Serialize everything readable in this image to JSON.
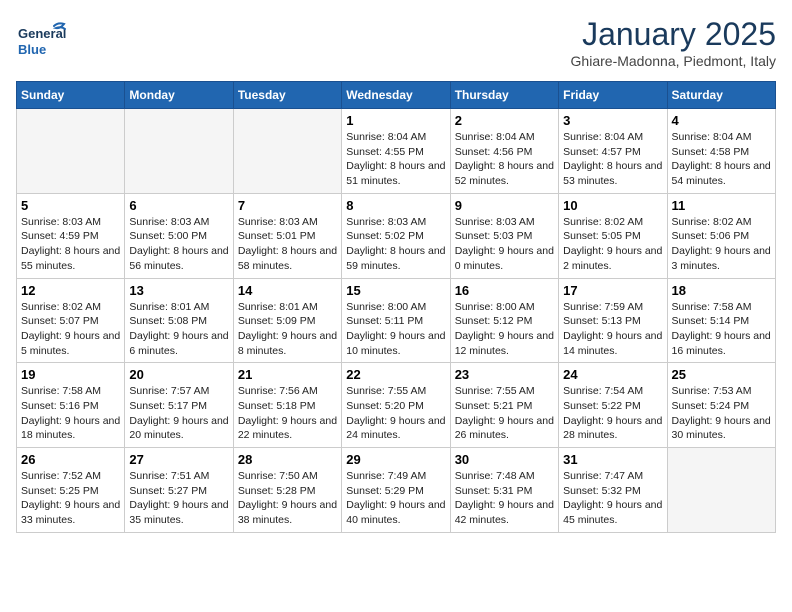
{
  "logo": {
    "general": "General",
    "blue": "Blue"
  },
  "title": "January 2025",
  "location": "Ghiare-Madonna, Piedmont, Italy",
  "days_of_week": [
    "Sunday",
    "Monday",
    "Tuesday",
    "Wednesday",
    "Thursday",
    "Friday",
    "Saturday"
  ],
  "weeks": [
    [
      {
        "num": "",
        "info": ""
      },
      {
        "num": "",
        "info": ""
      },
      {
        "num": "",
        "info": ""
      },
      {
        "num": "1",
        "info": "Sunrise: 8:04 AM\nSunset: 4:55 PM\nDaylight: 8 hours and 51 minutes."
      },
      {
        "num": "2",
        "info": "Sunrise: 8:04 AM\nSunset: 4:56 PM\nDaylight: 8 hours and 52 minutes."
      },
      {
        "num": "3",
        "info": "Sunrise: 8:04 AM\nSunset: 4:57 PM\nDaylight: 8 hours and 53 minutes."
      },
      {
        "num": "4",
        "info": "Sunrise: 8:04 AM\nSunset: 4:58 PM\nDaylight: 8 hours and 54 minutes."
      }
    ],
    [
      {
        "num": "5",
        "info": "Sunrise: 8:03 AM\nSunset: 4:59 PM\nDaylight: 8 hours and 55 minutes."
      },
      {
        "num": "6",
        "info": "Sunrise: 8:03 AM\nSunset: 5:00 PM\nDaylight: 8 hours and 56 minutes."
      },
      {
        "num": "7",
        "info": "Sunrise: 8:03 AM\nSunset: 5:01 PM\nDaylight: 8 hours and 58 minutes."
      },
      {
        "num": "8",
        "info": "Sunrise: 8:03 AM\nSunset: 5:02 PM\nDaylight: 8 hours and 59 minutes."
      },
      {
        "num": "9",
        "info": "Sunrise: 8:03 AM\nSunset: 5:03 PM\nDaylight: 9 hours and 0 minutes."
      },
      {
        "num": "10",
        "info": "Sunrise: 8:02 AM\nSunset: 5:05 PM\nDaylight: 9 hours and 2 minutes."
      },
      {
        "num": "11",
        "info": "Sunrise: 8:02 AM\nSunset: 5:06 PM\nDaylight: 9 hours and 3 minutes."
      }
    ],
    [
      {
        "num": "12",
        "info": "Sunrise: 8:02 AM\nSunset: 5:07 PM\nDaylight: 9 hours and 5 minutes."
      },
      {
        "num": "13",
        "info": "Sunrise: 8:01 AM\nSunset: 5:08 PM\nDaylight: 9 hours and 6 minutes."
      },
      {
        "num": "14",
        "info": "Sunrise: 8:01 AM\nSunset: 5:09 PM\nDaylight: 9 hours and 8 minutes."
      },
      {
        "num": "15",
        "info": "Sunrise: 8:00 AM\nSunset: 5:11 PM\nDaylight: 9 hours and 10 minutes."
      },
      {
        "num": "16",
        "info": "Sunrise: 8:00 AM\nSunset: 5:12 PM\nDaylight: 9 hours and 12 minutes."
      },
      {
        "num": "17",
        "info": "Sunrise: 7:59 AM\nSunset: 5:13 PM\nDaylight: 9 hours and 14 minutes."
      },
      {
        "num": "18",
        "info": "Sunrise: 7:58 AM\nSunset: 5:14 PM\nDaylight: 9 hours and 16 minutes."
      }
    ],
    [
      {
        "num": "19",
        "info": "Sunrise: 7:58 AM\nSunset: 5:16 PM\nDaylight: 9 hours and 18 minutes."
      },
      {
        "num": "20",
        "info": "Sunrise: 7:57 AM\nSunset: 5:17 PM\nDaylight: 9 hours and 20 minutes."
      },
      {
        "num": "21",
        "info": "Sunrise: 7:56 AM\nSunset: 5:18 PM\nDaylight: 9 hours and 22 minutes."
      },
      {
        "num": "22",
        "info": "Sunrise: 7:55 AM\nSunset: 5:20 PM\nDaylight: 9 hours and 24 minutes."
      },
      {
        "num": "23",
        "info": "Sunrise: 7:55 AM\nSunset: 5:21 PM\nDaylight: 9 hours and 26 minutes."
      },
      {
        "num": "24",
        "info": "Sunrise: 7:54 AM\nSunset: 5:22 PM\nDaylight: 9 hours and 28 minutes."
      },
      {
        "num": "25",
        "info": "Sunrise: 7:53 AM\nSunset: 5:24 PM\nDaylight: 9 hours and 30 minutes."
      }
    ],
    [
      {
        "num": "26",
        "info": "Sunrise: 7:52 AM\nSunset: 5:25 PM\nDaylight: 9 hours and 33 minutes."
      },
      {
        "num": "27",
        "info": "Sunrise: 7:51 AM\nSunset: 5:27 PM\nDaylight: 9 hours and 35 minutes."
      },
      {
        "num": "28",
        "info": "Sunrise: 7:50 AM\nSunset: 5:28 PM\nDaylight: 9 hours and 38 minutes."
      },
      {
        "num": "29",
        "info": "Sunrise: 7:49 AM\nSunset: 5:29 PM\nDaylight: 9 hours and 40 minutes."
      },
      {
        "num": "30",
        "info": "Sunrise: 7:48 AM\nSunset: 5:31 PM\nDaylight: 9 hours and 42 minutes."
      },
      {
        "num": "31",
        "info": "Sunrise: 7:47 AM\nSunset: 5:32 PM\nDaylight: 9 hours and 45 minutes."
      },
      {
        "num": "",
        "info": ""
      }
    ]
  ]
}
